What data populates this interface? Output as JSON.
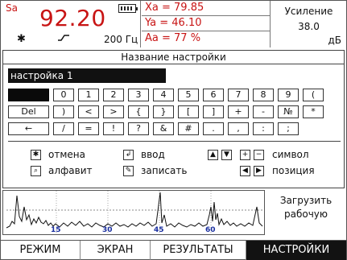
{
  "status": {
    "sa_label": "Sa",
    "sa_value": "92.20",
    "freq": "200 Гц",
    "battery_icon": "battery-icon",
    "readouts": [
      "Xa = 79.85",
      "Ya = 46.10",
      "Aa = 77 %"
    ],
    "gain_title": "Усиление",
    "gain_value": "38.0",
    "gain_unit": "дБ",
    "accent_color": "#c81414"
  },
  "dialog": {
    "title": "Название настройки",
    "name_value": "настройка 1",
    "keys_row1": [
      "",
      "0",
      "1",
      "2",
      "3",
      "4",
      "5",
      "6",
      "7",
      "8",
      "9",
      "("
    ],
    "keys_row2": [
      "Del",
      ")",
      "<",
      ">",
      "{",
      "}",
      "[",
      "]",
      "+",
      "-",
      "№",
      "*"
    ],
    "keys_row3": [
      "←",
      "/",
      "=",
      "!",
      "?",
      "&",
      "#",
      ".",
      ",",
      ":",
      ";"
    ],
    "legend": {
      "cancel": "отмена",
      "enter": "ввод",
      "symbol": "символ",
      "alphabet": "алфавит",
      "save": "записать",
      "position": "позиция"
    }
  },
  "graph": {
    "ticks": [
      "15",
      "30",
      "45",
      "60"
    ],
    "side_label_1": "Загрузить",
    "side_label_2": "рабочую"
  },
  "menu": {
    "tabs": [
      "РЕЖИМ",
      "ЭКРАН",
      "РЕЗУЛЬТАТЫ",
      "НАСТРОЙКИ"
    ],
    "active": "НАСТРОЙКИ"
  }
}
